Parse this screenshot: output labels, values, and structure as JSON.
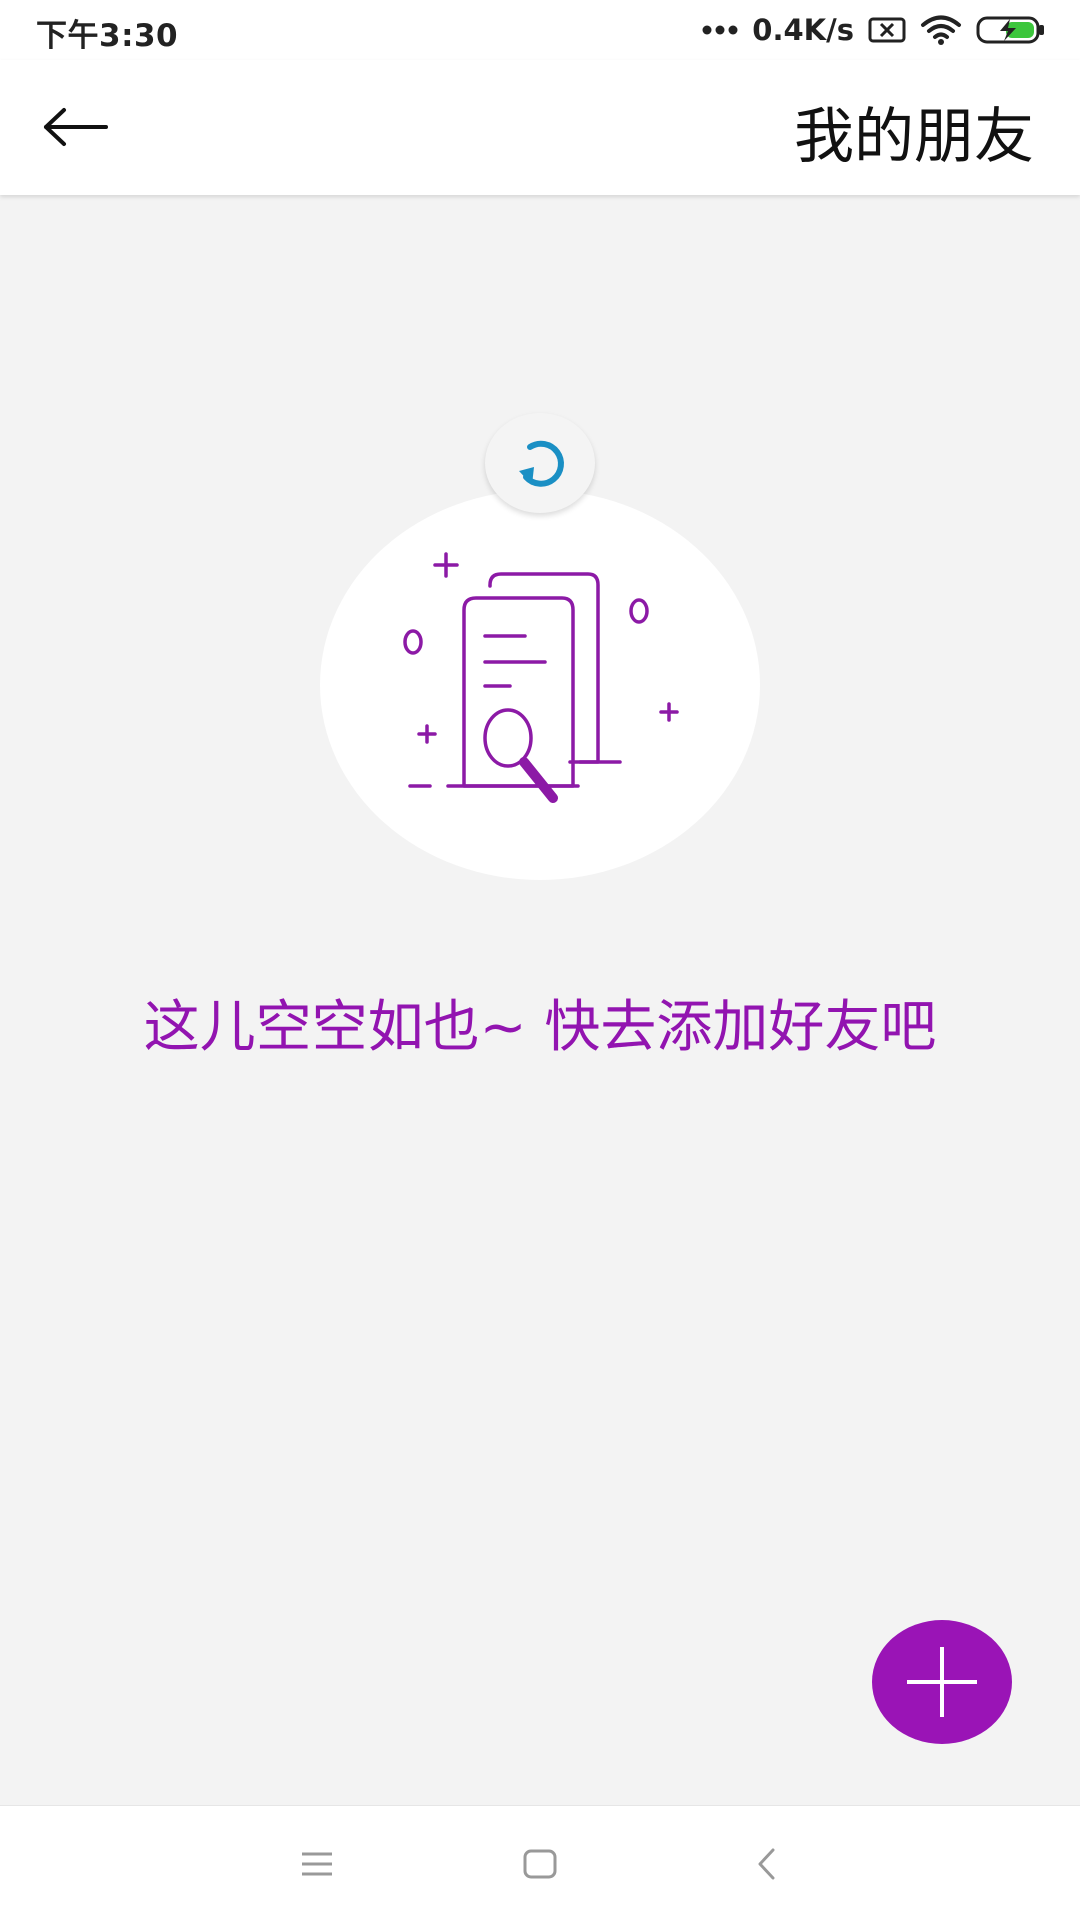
{
  "status_bar": {
    "time": "下午3:30",
    "network_speed": "0.4K/s",
    "icons": [
      "signal-dots-icon",
      "sim-disabled-icon",
      "wifi-icon",
      "battery-charging-icon"
    ]
  },
  "app_bar": {
    "back_icon": "arrow-left-icon",
    "title": "我的朋友"
  },
  "empty_state": {
    "illustration": "document-search-illustration",
    "refresh_icon": "refresh-icon",
    "message": "这儿空空如也~ 快去添加好友吧"
  },
  "fab": {
    "icon": "plus-icon"
  },
  "nav_bar": {
    "icons": [
      "menu-icon",
      "home-icon",
      "back-icon"
    ]
  },
  "colors": {
    "accent": "#9a14b6",
    "empty_text": "#9214b0",
    "refresh": "#1a8fc4",
    "background": "#f3f3f3"
  }
}
